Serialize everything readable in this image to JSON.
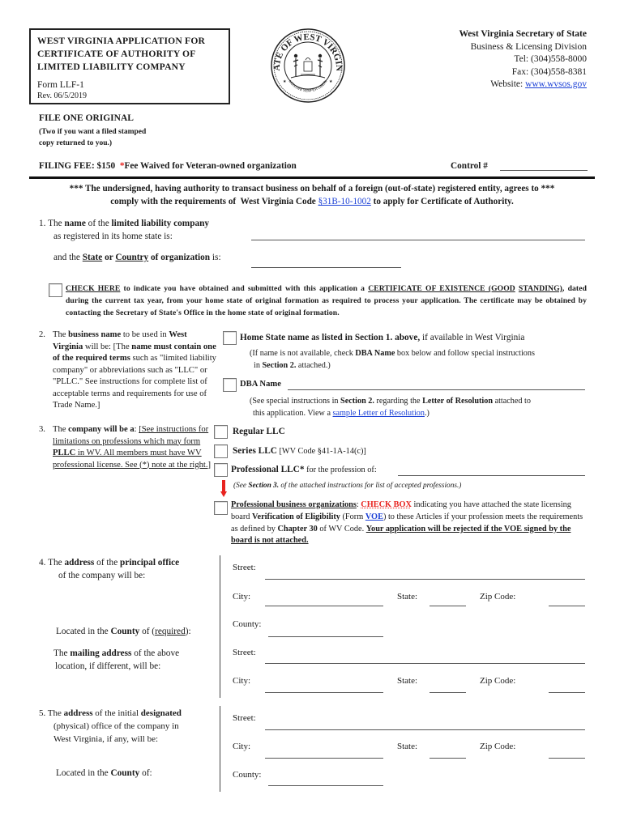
{
  "header": {
    "title_lines": [
      "WEST VIRGINIA APPLICATION FOR",
      "CERTIFICATE OF AUTHORITY OF",
      "LIMITED LIABILITY COMPANY"
    ],
    "form_number": "Form LLF-1",
    "revision": "Rev. 06/5/2019",
    "seal_icon": "state-seal-west-virginia",
    "office": {
      "name": "West Virginia Secretary of State",
      "division": "Business & Licensing Division",
      "tel": "Tel: (304)558-8000",
      "fax": "Fax: (304)558-8381",
      "website_label": "Website: ",
      "website_link": "www.wvsos.gov"
    }
  },
  "filing": {
    "file_one": "FILE ONE ORIGINAL",
    "file_sub_1": "(Two if you want a filed stamped",
    "file_sub_2": "copy returned to you.)",
    "fee_label": "FILING FEE",
    "fee_value": ": $150  ",
    "fee_asterisk": "*",
    "fee_waiver": "Fee Waived for Veteran-owned organization",
    "control_label": "Control # "
  },
  "declaration": {
    "line1": "*** The undersigned, having authority to transact business on behalf of a foreign (out-of-state) registered entity, agrees to ***",
    "line2_pre": "comply with the requirements of  West Virginia Code ",
    "code_link": "§31B-10-1002",
    "line2_post": " to apply for Certificate of Authority."
  },
  "section1": {
    "num": "1.",
    "t1": " The ",
    "b1": "name",
    "t2": " of the ",
    "b2": "limited liability company",
    "line2": "as registered in its home state is:",
    "c1": "and the ",
    "state": "State",
    "or": " or ",
    "country": "Country",
    "c2": " of organization",
    "c3": " is:",
    "name_value": "",
    "state_value": ""
  },
  "certificate": {
    "check_here": "CHECK HERE",
    "t1": " to indicate you have obtained and submitted with this application a ",
    "cert_name_1": "CERTIFICATE OF EXISTENCE (GOOD",
    "cert_name_2": "STANDING)",
    "t2": ", dated during the current tax year, from your home state of original formation as required to process your application. The certificate may be obtained by contacting the Secretary of State's Office in the home state of original formation.",
    "checked": false
  },
  "section2": {
    "num": "2.",
    "t1": "The ",
    "b1": "business name",
    "t2": " to be used in ",
    "b2": "West Virginia",
    "t3": " will be: [The ",
    "b3": "name must contain one of the required terms",
    "t4": " such as \"limited liability company\" or abbreviations such as \"LLC\" or \"PLLC.\" See instructions for complete list of acceptable terms and requirements for use of Trade Name.]",
    "option_home": {
      "bold": "Home State name as listed in Section 1. above,",
      "rest": " if available in West Virginia",
      "note_1": "(If name is not available, check ",
      "note_b1": "DBA Name",
      "note_2": " box below and follow special instructions",
      "note_3": "in ",
      "note_b2": "Section 2.",
      "note_4": " attached.)",
      "checked": false
    },
    "option_dba": {
      "label": "DBA Name",
      "value": "",
      "note_1": "(See special instructions in ",
      "note_b1": "Section 2.",
      "note_2": " regarding the ",
      "note_b2": "Letter of Resolution",
      "note_3": " attached to",
      "note_4": "this application. View a ",
      "note_link": "sample Letter of Resolution",
      "note_5": ".)",
      "checked": false
    }
  },
  "section3": {
    "num": "3.",
    "t1": "The ",
    "b1": "company will be a",
    "t2": ": ",
    "u1": "[See instructions for limitations on professions which may form ",
    "ub": "PLLC",
    "u2": " in WV. All members must have WV professional license. See (*) note at the right.]",
    "options": [
      {
        "bold": "Regular LLC",
        "rest": "",
        "checked": false
      },
      {
        "bold": "Series LLC",
        "rest": " [WV Code §41-1A-14(c)]",
        "checked": false
      },
      {
        "bold": "Professional LLC*",
        "rest": " for the profession of:",
        "value": "",
        "checked": false
      }
    ],
    "see_note_1": "(See ",
    "see_note_b": "Section 3.",
    "see_note_2": " of the attached instructions for list of accepted professions.)",
    "pbo": {
      "b1": "Professional business organizations",
      "t1": ": ",
      "checkbox_word": "CHECK BOX",
      "t2": " indicating you have attached the state licensing board ",
      "b2": "Verification of Eligibility",
      "t3": " (Form ",
      "voe_link": "VOE",
      "t4": ") to these Articles if your profession meets the requirements as defined by ",
      "b3": "Chapter 30",
      "t5": " of WV Code. ",
      "warning": "Your application will be rejected if the VOE signed by the board is not attached.",
      "checked": false
    }
  },
  "section4": {
    "num": "4.",
    "t1": " The ",
    "b1": "address",
    "t2": " of the ",
    "b2": "principal office",
    "line2": "of the company will be:",
    "county_pre": "Located in the ",
    "county_b": "County",
    "county_mid": " of (",
    "county_req": "required",
    "county_post": "):",
    "mail_pre": "The ",
    "mail_b": "mailing address",
    "mail_post": " of the above",
    "mail_line2": "location, if different, will be:"
  },
  "section5": {
    "num": "5.",
    "t1": " The ",
    "b1": "address",
    "t2": " of the initial ",
    "b2": "designated",
    "line2": "(physical) office of the company in",
    "line3": "West Virginia, if any, will be:",
    "county_pre": "Located in the ",
    "county_b": "County",
    "county_post": " of:"
  },
  "fields": {
    "street": "Street:",
    "city": "City:",
    "state": "State:",
    "zip": "Zip Code:",
    "county": "County:"
  },
  "colors": {
    "link": "#1a3fd6",
    "accent_red": "#e8231f"
  }
}
